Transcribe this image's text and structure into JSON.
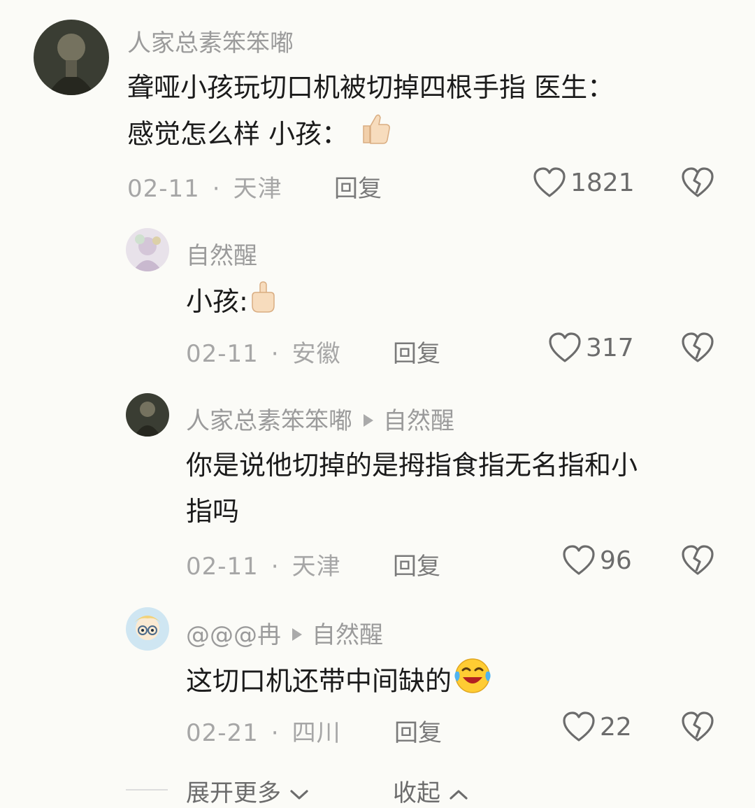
{
  "comments": [
    {
      "username": "人家总素笨笨嘟",
      "text_line1": "聋哑小孩玩切口机被切掉四根手指 医生：",
      "text_line2": "感觉怎么样 小孩：",
      "emoji": "thumbs-up",
      "date": "02-11",
      "location": "天津",
      "reply_label": "回复",
      "likes": "1821"
    },
    {
      "username": "自然醒",
      "text": "小孩:",
      "emoji": "middle-finger",
      "date": "02-11",
      "location": "安徽",
      "reply_label": "回复",
      "likes": "317"
    },
    {
      "username": "人家总素笨笨嘟",
      "reply_to": "自然醒",
      "text_line1": "你是说他切掉的是拇指食指无名指和小",
      "text_line2": "指吗",
      "date": "02-11",
      "location": "天津",
      "reply_label": "回复",
      "likes": "96"
    },
    {
      "username": "@@@冉",
      "reply_to": "自然醒",
      "text": "这切口机还带中间缺的",
      "emoji": "laughing-crying",
      "date": "02-21",
      "location": "四川",
      "reply_label": "回复",
      "likes": "22"
    }
  ],
  "footer": {
    "expand_label": "展开更多",
    "collapse_label": "收起"
  },
  "icons": {
    "like": "heart-icon",
    "dislike": "broken-heart-icon",
    "expand": "chevron-down-icon",
    "collapse": "chevron-up-icon"
  }
}
